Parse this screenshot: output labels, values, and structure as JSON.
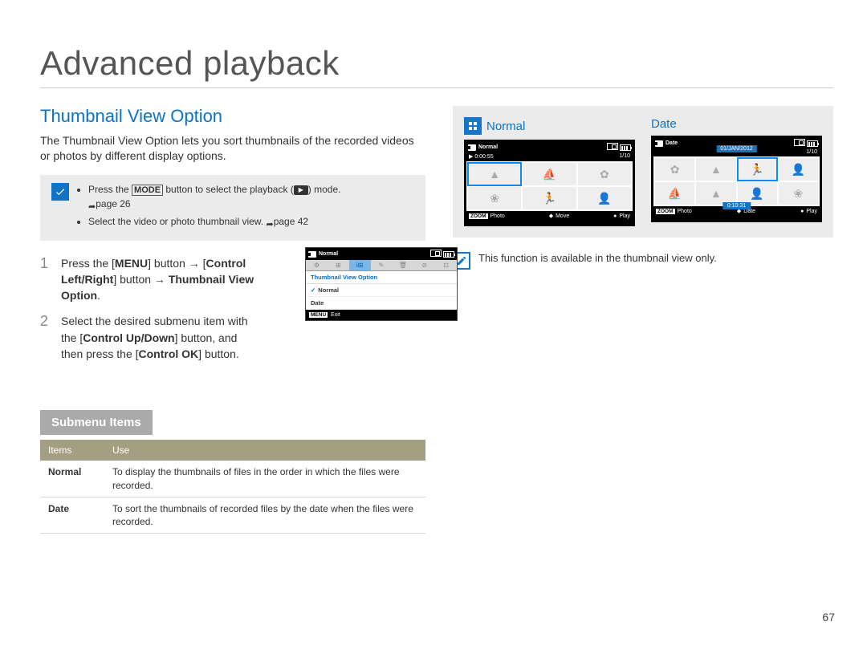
{
  "page": {
    "title": "Advanced playback",
    "number": "67"
  },
  "section": {
    "heading": "Thumbnail View Option",
    "intro": "The Thumbnail View Option lets you sort thumbnails of the recorded videos or photos by different display options."
  },
  "callout": {
    "bullet1_pre": "Press the ",
    "bullet1_mode": "MODE",
    "bullet1_mid": " button to select the playback (",
    "bullet1_post": ") mode.",
    "bullet1_ref": "page 26",
    "bullet2": "Select the video or photo thumbnail view.",
    "bullet2_ref": "page 42"
  },
  "steps": {
    "s1_num": "1",
    "s1_a": "Press the [",
    "s1_menu": "MENU",
    "s1_b": "] button ",
    "s1_c": "[",
    "s1_ctrl": "Control Left/Right",
    "s1_d": "] button ",
    "s1_e": "Thumbnail View Option",
    "s1_f": ".",
    "s2_num": "2",
    "s2_a": "Select the desired submenu item with the [",
    "s2_ctrl": "Control Up/Down",
    "s2_b": "] button, and then press the [",
    "s2_ok": "Control OK",
    "s2_c": "] button."
  },
  "lcd": {
    "top_label": "Normal",
    "menu_title": "Thumbnail View Option",
    "item_normal": "Normal",
    "item_date": "Date",
    "foot_tag": "MENU",
    "foot_exit": "Exit"
  },
  "submenu": {
    "heading": "Submenu Items",
    "th_items": "Items",
    "th_use": "Use",
    "r1_item": "Normal",
    "r1_use": "To display the thumbnails of files in the order in which the files were recorded.",
    "r2_item": "Date",
    "r2_use": "To sort the thumbnails of recorded files by the date when the files were recorded."
  },
  "previews": {
    "normal_label": "Normal",
    "date_label": "Date",
    "normal_top": "Normal",
    "date_top": "Date",
    "time": "0:00:55",
    "count": "1/10",
    "date_str": "01/JAN/2012",
    "duration": "0:10:31",
    "foot_zoom": "ZOOM",
    "foot_photo": "Photo",
    "foot_move": "Move",
    "foot_date": "Date",
    "foot_play": "Play"
  },
  "note": {
    "text": "This function is available in the thumbnail view only."
  }
}
